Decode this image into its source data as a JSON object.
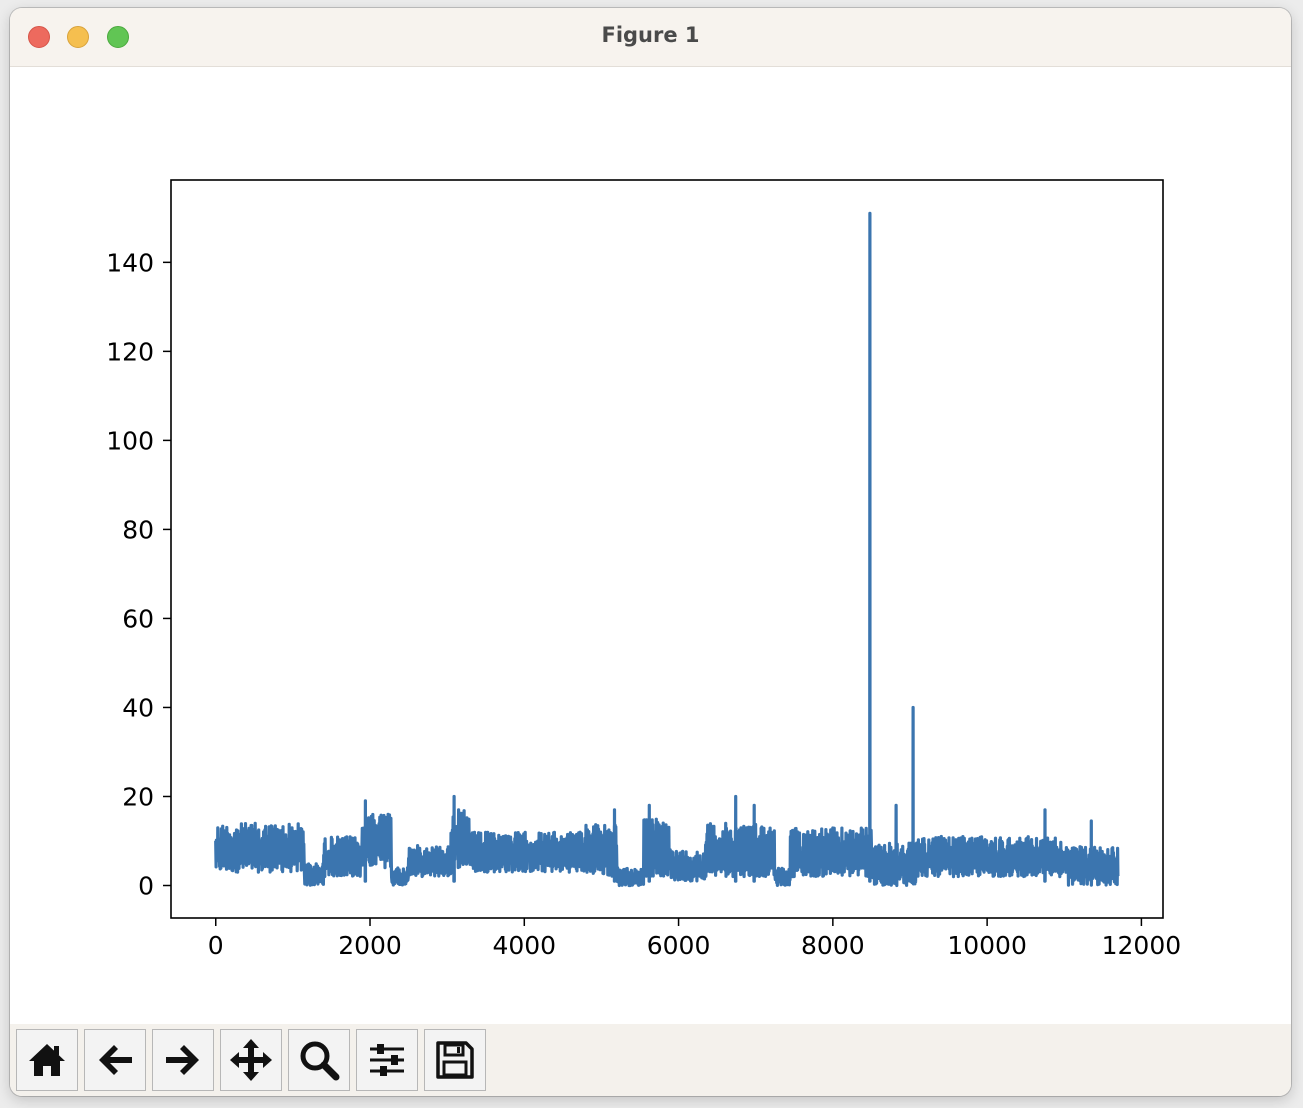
{
  "window": {
    "title": "Figure 1"
  },
  "toolbar": {
    "buttons": [
      {
        "name": "home",
        "icon": "home-icon"
      },
      {
        "name": "back",
        "icon": "arrow-left-icon"
      },
      {
        "name": "forward",
        "icon": "arrow-right-icon"
      },
      {
        "name": "pan",
        "icon": "move-icon"
      },
      {
        "name": "zoom",
        "icon": "magnifier-icon"
      },
      {
        "name": "configure-subplots",
        "icon": "sliders-icon"
      },
      {
        "name": "save",
        "icon": "floppy-disk-icon"
      }
    ]
  },
  "colors": {
    "line": "#3b75af",
    "titlebar": "#f7f3ee",
    "toolbar": "#f4f1ec"
  },
  "chart_data": {
    "type": "line",
    "title": "",
    "xlabel": "",
    "ylabel": "",
    "xlim": [
      -580,
      12280
    ],
    "ylim": [
      -7.3,
      158.5
    ],
    "xticks": [
      0,
      2000,
      4000,
      6000,
      8000,
      10000,
      12000
    ],
    "xtick_labels": [
      "0",
      "2000",
      "4000",
      "6000",
      "8000",
      "10000",
      "12000"
    ],
    "yticks": [
      0,
      20,
      40,
      60,
      80,
      100,
      120,
      140
    ],
    "ytick_labels": [
      "0",
      "20",
      "40",
      "60",
      "80",
      "100",
      "120",
      "140"
    ],
    "grid": false,
    "legend": "none",
    "series": [
      {
        "x_range": [
          0,
          11700
        ],
        "typical_range": [
          0,
          20
        ],
        "segments": [
          {
            "x": [
              0,
              1150
            ],
            "low": 3,
            "high": 14
          },
          {
            "x": [
              1150,
              1400
            ],
            "low": 0,
            "high": 5
          },
          {
            "x": [
              1400,
              1900
            ],
            "low": 2,
            "high": 11
          },
          {
            "x": [
              1900,
              2280
            ],
            "low": 4,
            "high": 16
          },
          {
            "x": [
              2280,
              2500
            ],
            "low": 0,
            "high": 4
          },
          {
            "x": [
              2500,
              3050
            ],
            "low": 2,
            "high": 9
          },
          {
            "x": [
              3050,
              3300
            ],
            "low": 4,
            "high": 17
          },
          {
            "x": [
              3300,
              4800
            ],
            "low": 3,
            "high": 12
          },
          {
            "x": [
              4800,
              5200
            ],
            "low": 2,
            "high": 14
          },
          {
            "x": [
              5200,
              5550
            ],
            "low": 0,
            "high": 4
          },
          {
            "x": [
              5550,
              5900
            ],
            "low": 2,
            "high": 15
          },
          {
            "x": [
              5900,
              6350
            ],
            "low": 1,
            "high": 8
          },
          {
            "x": [
              6350,
              7250
            ],
            "low": 2,
            "high": 14
          },
          {
            "x": [
              7250,
              7450
            ],
            "low": 0,
            "high": 4
          },
          {
            "x": [
              7450,
              8500
            ],
            "low": 2,
            "high": 13
          },
          {
            "x": [
              8500,
              9100
            ],
            "low": 0,
            "high": 10
          },
          {
            "x": [
              9100,
              11050
            ],
            "low": 2,
            "high": 11
          },
          {
            "x": [
              11050,
              11700
            ],
            "low": 0,
            "high": 9
          }
        ],
        "spikes": [
          {
            "x": 1940,
            "y": 19
          },
          {
            "x": 3090,
            "y": 20
          },
          {
            "x": 5170,
            "y": 17
          },
          {
            "x": 5620,
            "y": 18
          },
          {
            "x": 6740,
            "y": 20
          },
          {
            "x": 6980,
            "y": 18
          },
          {
            "x": 8480,
            "y": 151
          },
          {
            "x": 8820,
            "y": 18
          },
          {
            "x": 9040,
            "y": 40
          },
          {
            "x": 10750,
            "y": 17
          },
          {
            "x": 11350,
            "y": 14.5
          }
        ]
      }
    ]
  }
}
